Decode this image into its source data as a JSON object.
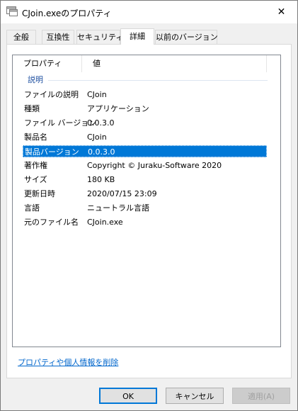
{
  "window": {
    "title": "CJoin.exeのプロパティ",
    "icon": "file-icon",
    "close_glyph": "✕"
  },
  "tabs": [
    {
      "label": "全般",
      "active": false
    },
    {
      "label": "互換性",
      "active": false
    },
    {
      "label": "セキュリティ",
      "active": false
    },
    {
      "label": "詳細",
      "active": true
    },
    {
      "label": "以前のバージョン",
      "active": false
    }
  ],
  "list": {
    "columns": {
      "property": "プロパティ",
      "value": "値"
    },
    "group": "説明",
    "rows": [
      {
        "property": "ファイルの説明",
        "value": "CJoin"
      },
      {
        "property": "種類",
        "value": "アプリケーション"
      },
      {
        "property": "ファイル バージョン",
        "value": "0.0.3.0"
      },
      {
        "property": "製品名",
        "value": "CJoin"
      },
      {
        "property": "製品バージョン",
        "value": "0.0.3.0",
        "selected": true
      },
      {
        "property": "著作権",
        "value": "Copyright © Juraku-Software 2020"
      },
      {
        "property": "サイズ",
        "value": "180 KB"
      },
      {
        "property": "更新日時",
        "value": "2020/07/15 23:09"
      },
      {
        "property": "言語",
        "value": "ニュートラル言語"
      },
      {
        "property": "元のファイル名",
        "value": "CJoin.exe"
      }
    ]
  },
  "remove_link": "プロパティや個人情報を削除",
  "buttons": {
    "ok": "OK",
    "cancel": "キャンセル",
    "apply": "適用(A)"
  },
  "colors": {
    "selection": "#0078d7",
    "link": "#0066cc",
    "group_header": "#1e4fa0"
  }
}
